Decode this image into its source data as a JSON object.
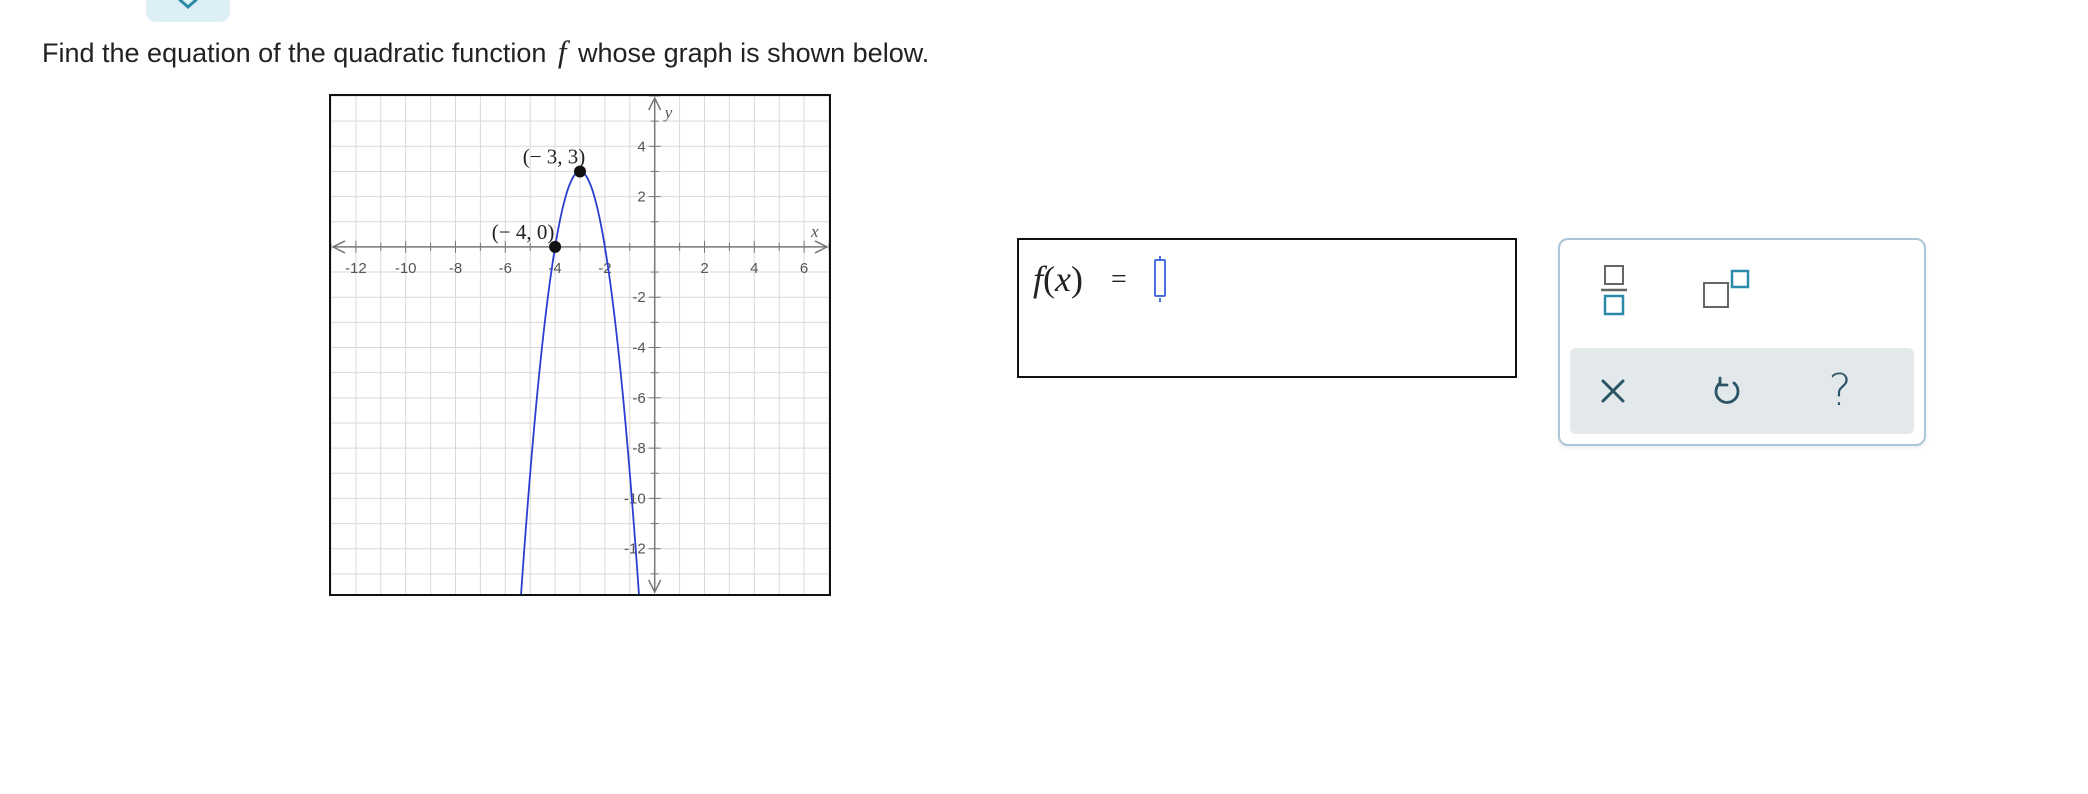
{
  "question": {
    "prefix": "Find the equation of the quadratic function",
    "variable": "f",
    "suffix": "whose graph is shown below."
  },
  "graph": {
    "x_axis_label": "x",
    "y_axis_label": "y",
    "x_range": [
      -13,
      7
    ],
    "y_range": [
      -13.8,
      6
    ],
    "x_tick_labels": [
      "-12",
      "-10",
      "-8",
      "-6",
      "-4",
      "-2",
      "2",
      "4",
      "6"
    ],
    "y_tick_labels": [
      "4",
      "2",
      "-2",
      "-4",
      "-6",
      "-8",
      "-10",
      "-12"
    ],
    "curve": {
      "equation_form": "vertex",
      "vertex": [
        -3,
        3
      ],
      "a": -3
    },
    "points": [
      {
        "label": "(− 3, 3)",
        "x": -3,
        "y": 3
      },
      {
        "label": "(− 4, 0)",
        "x": -4,
        "y": 0
      }
    ],
    "curve_color": "#2a3fd1",
    "grid_color": "#d9d9d9"
  },
  "answer": {
    "lhs_func": "f",
    "lhs_open": "(",
    "lhs_var": "x",
    "lhs_close": ")",
    "equals": "=",
    "value": ""
  },
  "toolbar": {
    "buttons": [
      "fraction-icon",
      "exponent-icon"
    ],
    "actions": [
      "clear-icon",
      "undo-icon",
      "help-icon"
    ],
    "icon_color": "#2c8aa8",
    "action_icon_color": "#2b5566",
    "help_label": "?"
  }
}
